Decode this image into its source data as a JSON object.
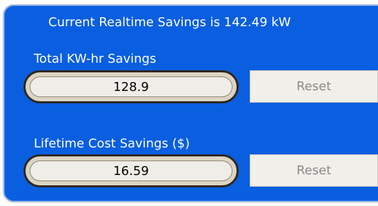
{
  "header": {
    "realtime_text": "Current Realtime Savings is 142.49 kW"
  },
  "kwh": {
    "label": "Total KW-hr Savings",
    "value": "128.9",
    "reset_label": "Reset"
  },
  "cost": {
    "label": "Lifetime Cost Savings ($)",
    "value": "16.59",
    "reset_label": "Reset"
  },
  "colors": {
    "panel_blue": "#0a5fe0",
    "field_fill": "#efede7",
    "button_fill": "#f0efea",
    "button_text_disabled": "#8a8a8a"
  }
}
